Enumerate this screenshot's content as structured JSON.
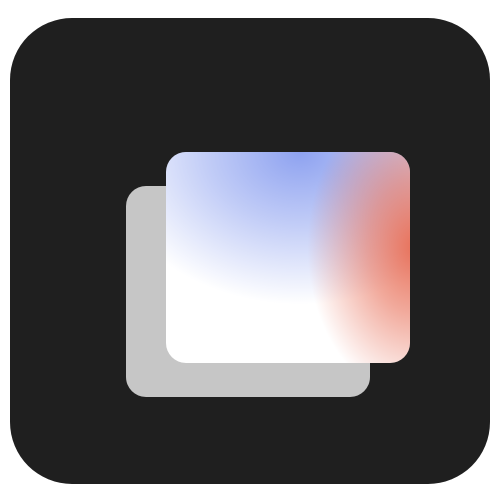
{
  "icon": {
    "name": "stacked-windows-app-icon",
    "colors": {
      "background": "#1f1f1f",
      "back_card": "#c6c6c6",
      "front_card_base": "#ffffff",
      "gradient_blue": "#8ea2f0",
      "gradient_coral": "#e8715a"
    }
  }
}
